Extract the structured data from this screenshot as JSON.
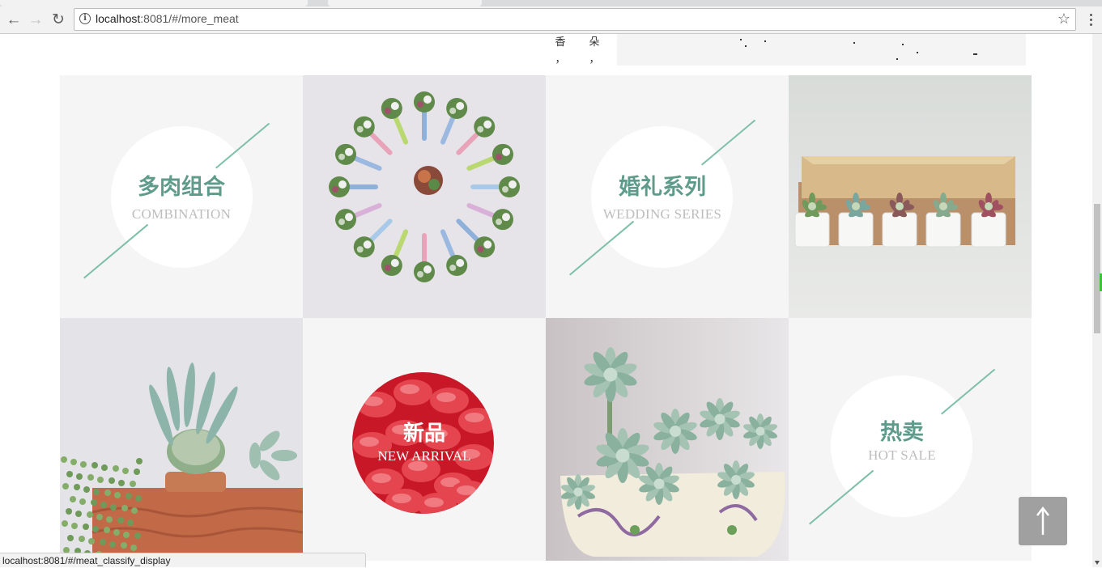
{
  "browser": {
    "url_host": "localhost",
    "url_rest": ":8081/#/more_meat",
    "status_link": "localhost:8081/#/meat_classify_display"
  },
  "top_strip": {
    "text_col1": [
      "香",
      "，"
    ],
    "text_col2": [
      "朵",
      "，"
    ]
  },
  "categories": [
    {
      "title": "多肉组合",
      "subtitle": "COMBINATION"
    },
    {
      "title": "婚礼系列",
      "subtitle": "WEDDING SERIES"
    },
    {
      "title": "新品",
      "subtitle": "NEW ARRIVAL"
    },
    {
      "title": "热卖",
      "subtitle": "HOT  SALE"
    }
  ],
  "images": [
    {
      "icon": "boutonniere-wreath-photo"
    },
    {
      "icon": "potted-succulents-box-photo"
    },
    {
      "icon": "cactus-pot-photo"
    },
    {
      "icon": "succulent-bowl-photo"
    }
  ],
  "colors": {
    "accent_green": "#5f9b8a",
    "line_green": "#7dbfaa",
    "cell_bg": "#f5f5f5",
    "to_top_bg": "#a0a0a0"
  }
}
